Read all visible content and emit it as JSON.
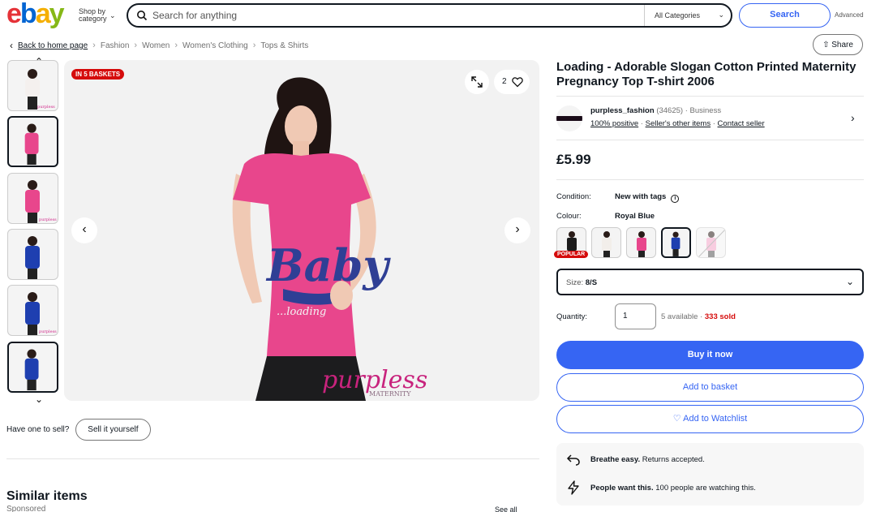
{
  "header": {
    "logo_letters": [
      "e",
      "b",
      "a",
      "y"
    ],
    "logo_colors": [
      "#e53238",
      "#0064d2",
      "#f5af02",
      "#86b817"
    ],
    "shop_by_line1": "Shop by",
    "shop_by_line2": "category",
    "search_placeholder": "Search for anything",
    "category_select": "All Categories",
    "search_button": "Search",
    "advanced_link": "Advanced"
  },
  "breadcrumb": {
    "back": "Back to home page",
    "items": [
      "Fashion",
      "Women",
      "Women's Clothing",
      "Tops & Shirts"
    ]
  },
  "share_button": "Share",
  "gallery": {
    "badge": "IN 5 BASKETS",
    "watch_count": "2",
    "thumb_count": 6,
    "active_thumb_index": 1
  },
  "sell": {
    "prompt": "Have one to sell?",
    "button": "Sell it yourself"
  },
  "similar": {
    "title": "Similar items",
    "sponsored": "Sponsored",
    "see_all": "See all"
  },
  "product": {
    "title": "Loading - Adorable Slogan Cotton Printed Maternity Pregnancy Top T-shirt 2006",
    "seller": {
      "name": "purpless_fashion",
      "feedback_count": "(34625)",
      "type": "Business",
      "positive": "100% positive",
      "other_items": "Seller's other items",
      "contact": "Contact seller"
    },
    "price": "£5.99",
    "condition_label": "Condition:",
    "condition_value": "New with tags",
    "colour_label": "Colour:",
    "colour_value": "Royal Blue",
    "popular_badge": "POPULAR",
    "size_label": "Size:",
    "size_value": "8/S",
    "quantity_label": "Quantity:",
    "quantity_value": "1",
    "available": "5 available",
    "sold": "333 sold",
    "buy_now": "Buy it now",
    "add_basket": "Add to basket",
    "add_watchlist": "Add to Watchlist",
    "returns_bold": "Breathe easy.",
    "returns_text": "Returns accepted.",
    "watching_bold": "People want this.",
    "watching_text": "100 people are watching this."
  },
  "colors": {
    "accent_blue": "#3665f3",
    "badge_red": "#d50b0b",
    "shirt_pink": "#e8468c",
    "shirt_blue": "#1e3fb0"
  }
}
